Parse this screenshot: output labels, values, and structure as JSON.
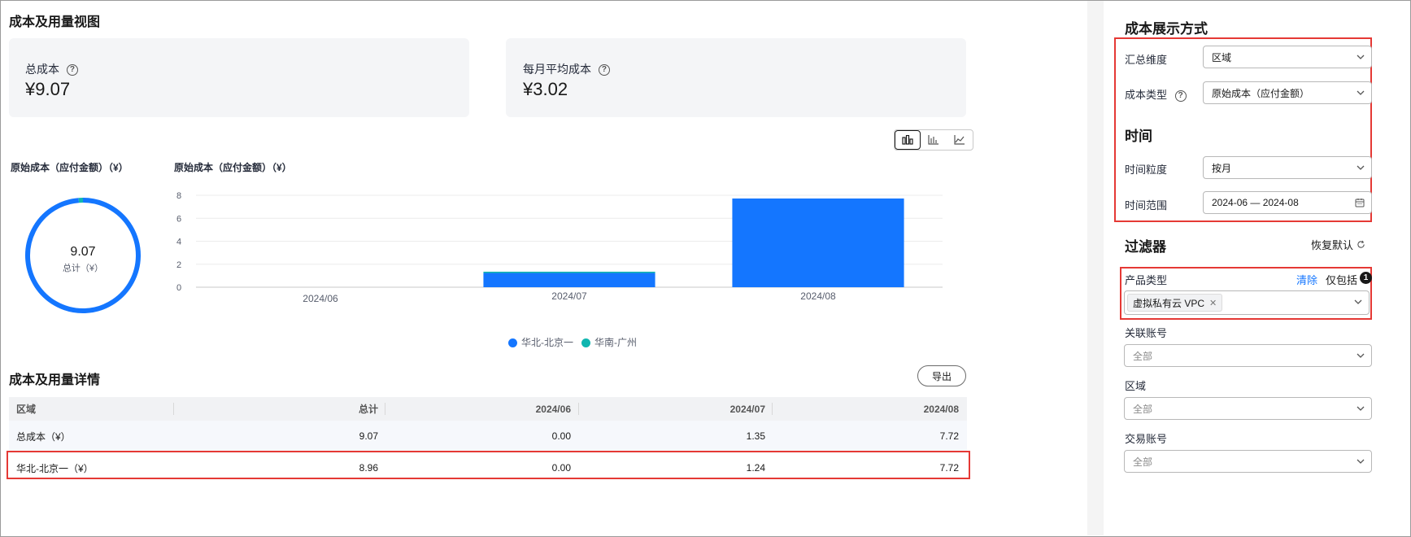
{
  "main": {
    "title": "成本及用量视图",
    "cards": [
      {
        "label": "总成本",
        "value": "¥9.07"
      },
      {
        "label": "每月平均成本",
        "value": "¥3.02"
      }
    ],
    "donut": {
      "title": "原始成本（应付金额）（¥）",
      "total": "9.07",
      "total_label": "总计（¥）"
    },
    "bar": {
      "title": "原始成本（应付金额）（¥）"
    },
    "details_title": "成本及用量详情",
    "export_label": "导出",
    "table": {
      "headers": [
        "区域",
        "总计",
        "2024/06",
        "2024/07",
        "2024/08"
      ],
      "rows": [
        [
          "总成本（¥）",
          "9.07",
          "0.00",
          "1.35",
          "7.72"
        ],
        [
          "华北-北京一（¥）",
          "8.96",
          "0.00",
          "1.24",
          "7.72"
        ]
      ]
    }
  },
  "chart_data": [
    {
      "type": "pie",
      "title": "原始成本（应付金额）（¥）",
      "slices": [
        {
          "name": "华北-北京一",
          "value": 8.96,
          "color": "#1476ff"
        },
        {
          "name": "华南-广州",
          "value": 0.11,
          "color": "#10b6b0"
        }
      ],
      "center_value": "9.07",
      "center_label": "总计（¥）"
    },
    {
      "type": "bar",
      "stacked": true,
      "title": "原始成本（应付金额）（¥）",
      "categories": [
        "2024/06",
        "2024/07",
        "2024/08"
      ],
      "series": [
        {
          "name": "华北-北京一",
          "color": "#1476ff",
          "values": [
            0,
            1.24,
            7.72
          ]
        },
        {
          "name": "华南-广州",
          "color": "#10b6b0",
          "values": [
            0,
            0.11,
            0
          ]
        }
      ],
      "ylim": [
        0,
        8
      ],
      "yticks": [
        0,
        2,
        4,
        6,
        8
      ],
      "grid": true,
      "legend": "bottom"
    }
  ],
  "side": {
    "display_title": "成本展示方式",
    "summary_label": "汇总维度",
    "summary_value": "区域",
    "cost_type_label": "成本类型",
    "cost_type_value": "原始成本（应付金额）",
    "time_title": "时间",
    "granularity_label": "时间粒度",
    "granularity_value": "按月",
    "range_label": "时间范围",
    "range_value": "2024-06 — 2024-08",
    "filter_title": "过滤器",
    "reset_label": "恢复默认",
    "product_label": "产品类型",
    "clear_label": "清除",
    "only_label": "仅包括",
    "only_count": "1",
    "product_tag": "虚拟私有云 VPC",
    "account_label": "关联账号",
    "account_value": "全部",
    "region_label": "区域",
    "region_value": "全部",
    "trade_label": "交易账号",
    "trade_value": "全部"
  },
  "colors": {
    "accent": "#1476ff",
    "teal": "#10b6b0",
    "highlight": "#e53935"
  }
}
